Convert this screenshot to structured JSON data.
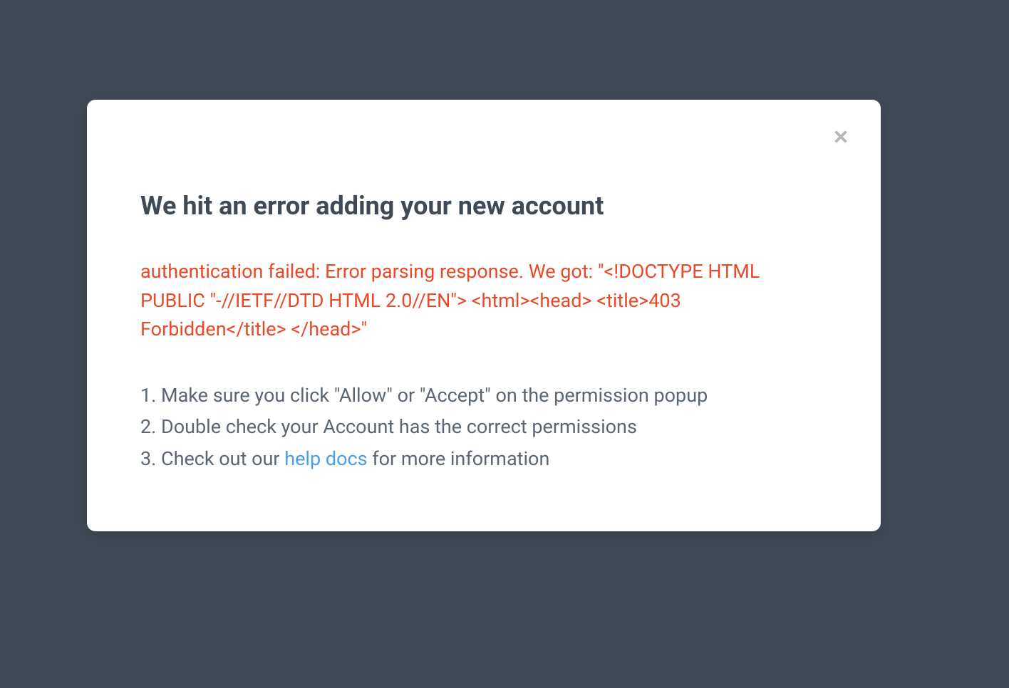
{
  "modal": {
    "title": "We hit an error adding your new account",
    "error_message": "authentication failed: Error parsing response. We got: \"<!DOCTYPE HTML PUBLIC \"-//IETF//DTD HTML 2.0//EN\"> <html><head> <title>403 Forbidden</title> </head>\"",
    "steps": [
      {
        "number": "1.",
        "text": "Make sure you click \"Allow\" or \"Accept\" on the permission popup"
      },
      {
        "number": "2.",
        "text": "Double check your Account has the correct permissions"
      },
      {
        "number": "3.",
        "text_before": "Check out our ",
        "link_text": "help docs",
        "text_after": " for more information"
      }
    ]
  }
}
